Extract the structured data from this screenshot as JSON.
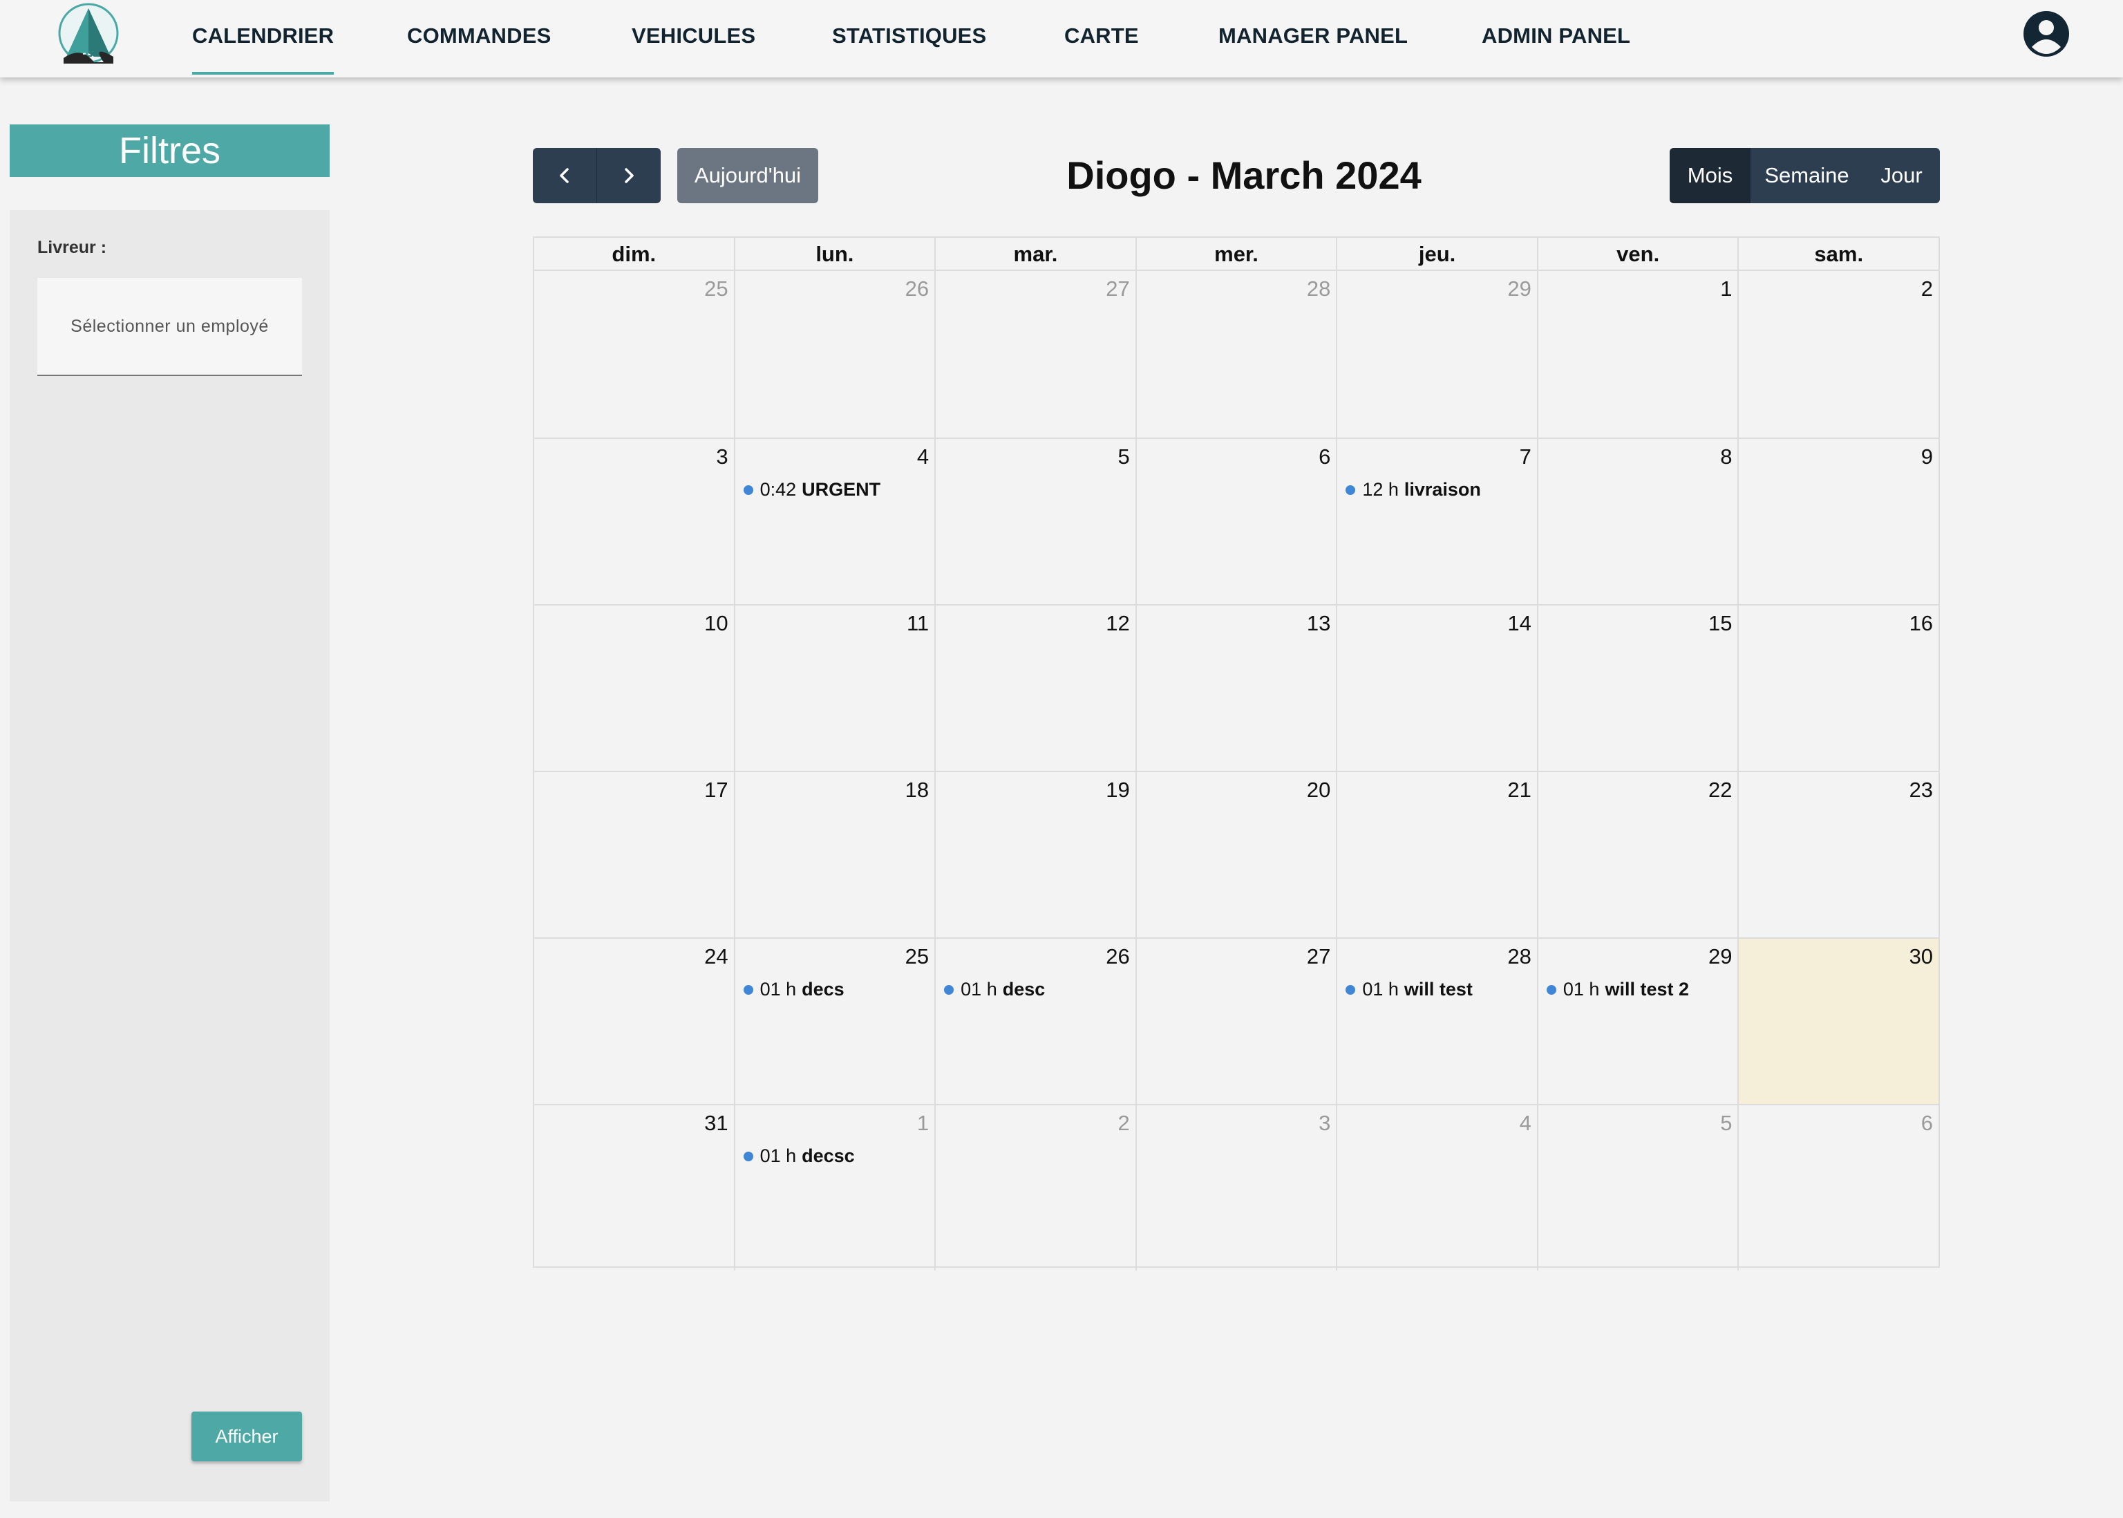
{
  "nav": {
    "items": [
      {
        "label": "CALENDRIER",
        "active": true
      },
      {
        "label": "COMMANDES"
      },
      {
        "label": "VEHICULES"
      },
      {
        "label": "STATISTIQUES"
      },
      {
        "label": "CARTE"
      },
      {
        "label": "MANAGER PANEL"
      },
      {
        "label": "ADMIN PANEL"
      }
    ],
    "profile_icon": "account-circle-icon",
    "accent_color": "#4aa9a4"
  },
  "sidebar": {
    "title": "Filtres",
    "livreur_label": "Livreur :",
    "select_placeholder": "Sélectionner un employé",
    "submit_label": "Afficher",
    "color": "#4ea9a6"
  },
  "calendar": {
    "title": "Diogo - March 2024",
    "today_label": "Aujourd'hui",
    "views": [
      "Mois",
      "Semaine",
      "Jour"
    ],
    "active_view": "Mois",
    "weekdays": [
      "dim.",
      "lun.",
      "mar.",
      "mer.",
      "jeu.",
      "ven.",
      "sam."
    ],
    "event_color": "#3f86d7",
    "today_color": "#f5efd9",
    "weeks": [
      [
        {
          "num": "25",
          "other": true
        },
        {
          "num": "26",
          "other": true
        },
        {
          "num": "27",
          "other": true
        },
        {
          "num": "28",
          "other": true
        },
        {
          "num": "29",
          "other": true
        },
        {
          "num": "1"
        },
        {
          "num": "2"
        }
      ],
      [
        {
          "num": "3"
        },
        {
          "num": "4",
          "event": {
            "time": "0:42",
            "title": "URGENT"
          }
        },
        {
          "num": "5"
        },
        {
          "num": "6"
        },
        {
          "num": "7",
          "event": {
            "time": "12 h",
            "title": "livraison"
          }
        },
        {
          "num": "8"
        },
        {
          "num": "9"
        }
      ],
      [
        {
          "num": "10"
        },
        {
          "num": "11"
        },
        {
          "num": "12"
        },
        {
          "num": "13"
        },
        {
          "num": "14"
        },
        {
          "num": "15"
        },
        {
          "num": "16"
        }
      ],
      [
        {
          "num": "17"
        },
        {
          "num": "18"
        },
        {
          "num": "19"
        },
        {
          "num": "20"
        },
        {
          "num": "21"
        },
        {
          "num": "22"
        },
        {
          "num": "23"
        }
      ],
      [
        {
          "num": "24"
        },
        {
          "num": "25",
          "event": {
            "time": "01 h",
            "title": "decs"
          }
        },
        {
          "num": "26",
          "event": {
            "time": "01 h",
            "title": "desc"
          }
        },
        {
          "num": "27"
        },
        {
          "num": "28",
          "event": {
            "time": "01 h",
            "title": "will test"
          }
        },
        {
          "num": "29",
          "event": {
            "time": "01 h",
            "title": "will test 2"
          }
        },
        {
          "num": "30",
          "today": true
        }
      ],
      [
        {
          "num": "31"
        },
        {
          "num": "1",
          "other": true,
          "event": {
            "time": "01 h",
            "title": "decsc"
          }
        },
        {
          "num": "2",
          "other": true
        },
        {
          "num": "3",
          "other": true
        },
        {
          "num": "4",
          "other": true
        },
        {
          "num": "5",
          "other": true
        },
        {
          "num": "6",
          "other": true
        }
      ]
    ]
  }
}
